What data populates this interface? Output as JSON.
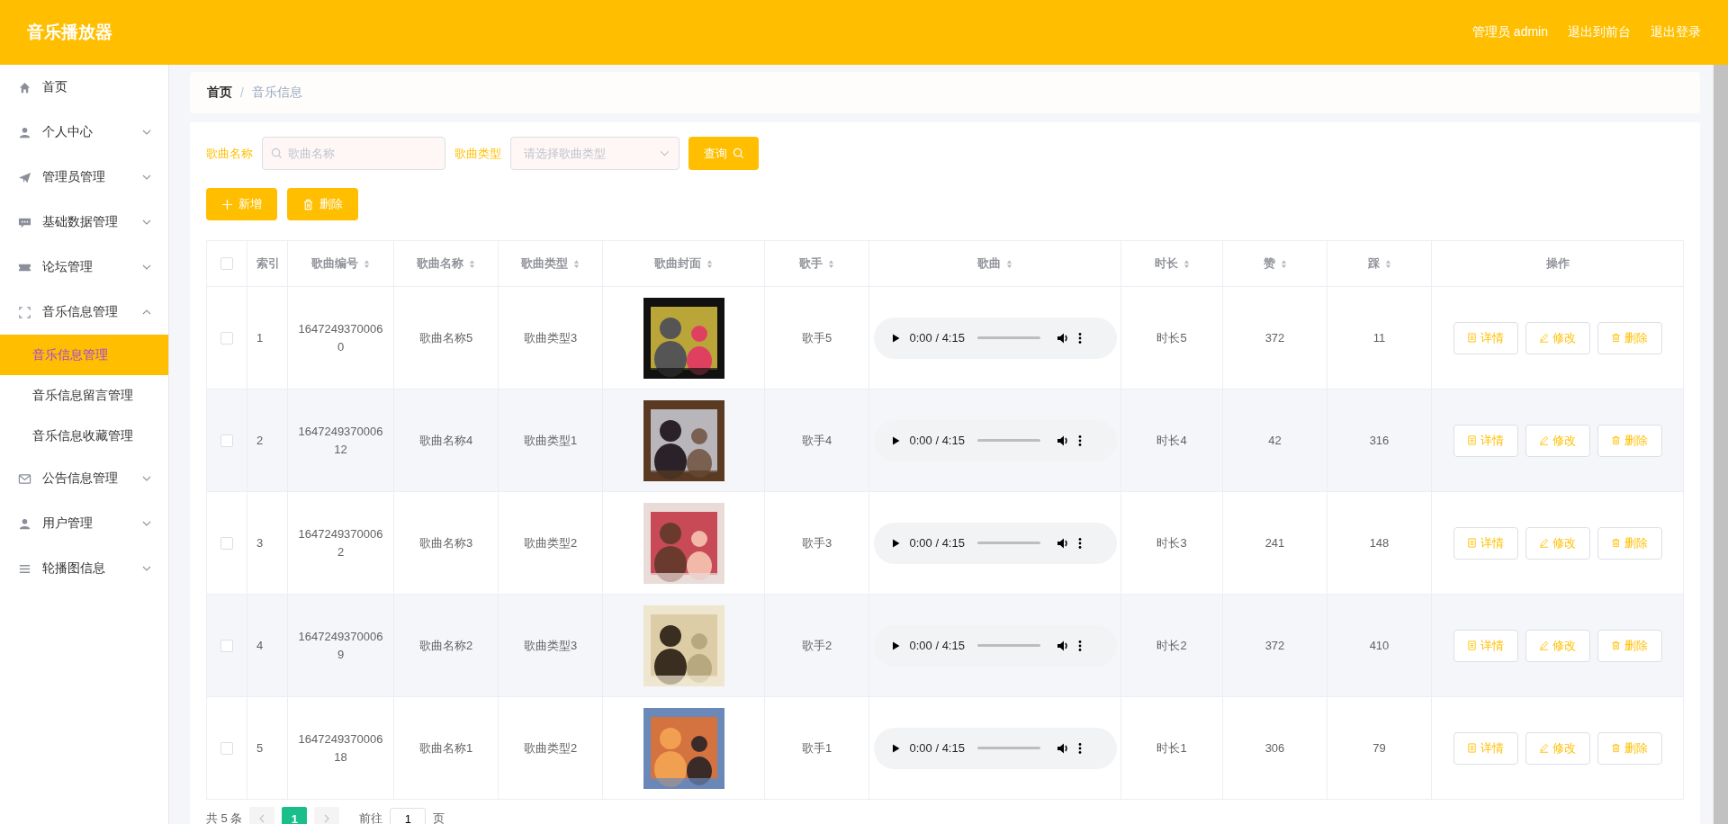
{
  "header": {
    "title": "音乐播放器",
    "user": "管理员 admin",
    "links": [
      "退出到前台",
      "退出登录"
    ]
  },
  "sidebar": {
    "items": [
      {
        "label": "首页",
        "selected": false
      },
      {
        "label": "个人中心",
        "selected": false,
        "expanded": false
      },
      {
        "label": "管理员管理",
        "selected": false,
        "expanded": false
      },
      {
        "label": "基础数据管理",
        "selected": false,
        "expanded": false
      },
      {
        "label": "论坛管理",
        "selected": false,
        "expanded": false
      },
      {
        "label": "音乐信息管理",
        "selected": false,
        "expanded": true,
        "children": [
          {
            "label": "音乐信息管理",
            "selected": true
          },
          {
            "label": "音乐信息留言管理",
            "selected": false
          },
          {
            "label": "音乐信息收藏管理",
            "selected": false
          }
        ]
      },
      {
        "label": "公告信息管理",
        "selected": false,
        "expanded": false
      },
      {
        "label": "用户管理",
        "selected": false,
        "expanded": false
      },
      {
        "label": "轮播图信息",
        "selected": false,
        "expanded": false
      }
    ]
  },
  "breadcrumb": {
    "separator": "/",
    "items": [
      "首页",
      "音乐信息"
    ]
  },
  "search": {
    "fields": [
      {
        "kind": "text",
        "label": "歌曲名称",
        "placeholder": "歌曲名称"
      },
      {
        "kind": "select",
        "label": "歌曲类型",
        "placeholder": "请选择歌曲类型"
      }
    ],
    "button": "查询"
  },
  "actions": [
    "新增",
    "删除"
  ],
  "table": {
    "select_all_checked": false,
    "columns": [
      {
        "label": "索引",
        "sortable": false
      },
      {
        "label": "歌曲编号",
        "sortable": true
      },
      {
        "label": "歌曲名称",
        "sortable": true
      },
      {
        "label": "歌曲类型",
        "sortable": true
      },
      {
        "label": "歌曲封面",
        "sortable": true
      },
      {
        "label": "歌手",
        "sortable": true
      },
      {
        "label": "歌曲",
        "sortable": true
      },
      {
        "label": "时长",
        "sortable": true
      },
      {
        "label": "赞",
        "sortable": true
      },
      {
        "label": "踩",
        "sortable": true
      },
      {
        "label": "操作",
        "sortable": false
      }
    ],
    "rows": [
      {
        "checked": false,
        "index": "1",
        "id": "16472493700060",
        "name": "歌曲名称5",
        "type": "歌曲类型3",
        "singer": "歌手5",
        "time": "0:00 / 4:15",
        "duration": "时长5",
        "likes": "372",
        "dislikes": "11",
        "buttons": [
          "详情",
          "修改",
          "删除"
        ]
      },
      {
        "checked": false,
        "index": "2",
        "id": "164724937000612",
        "name": "歌曲名称4",
        "type": "歌曲类型1",
        "singer": "歌手4",
        "time": "0:00 / 4:15",
        "duration": "时长4",
        "likes": "42",
        "dislikes": "316",
        "buttons": [
          "详情",
          "修改",
          "删除"
        ]
      },
      {
        "checked": false,
        "index": "3",
        "id": "16472493700062",
        "name": "歌曲名称3",
        "type": "歌曲类型2",
        "singer": "歌手3",
        "time": "0:00 / 4:15",
        "duration": "时长3",
        "likes": "241",
        "dislikes": "148",
        "buttons": [
          "详情",
          "修改",
          "删除"
        ]
      },
      {
        "checked": false,
        "index": "4",
        "id": "16472493700069",
        "name": "歌曲名称2",
        "type": "歌曲类型3",
        "singer": "歌手2",
        "time": "0:00 / 4:15",
        "duration": "时长2",
        "likes": "372",
        "dislikes": "410",
        "buttons": [
          "详情",
          "修改",
          "删除"
        ]
      },
      {
        "checked": false,
        "index": "5",
        "id": "164724937000618",
        "name": "歌曲名称1",
        "type": "歌曲类型2",
        "singer": "歌手1",
        "time": "0:00 / 4:15",
        "duration": "时长1",
        "likes": "306",
        "dislikes": "79",
        "buttons": [
          "详情",
          "修改",
          "删除"
        ]
      }
    ]
  },
  "pagination": {
    "total": "共 5 条",
    "pages": [
      {
        "label": "1",
        "selected": true
      }
    ],
    "goto_label": "前往",
    "goto_value": "1",
    "goto_suffix": "页"
  }
}
